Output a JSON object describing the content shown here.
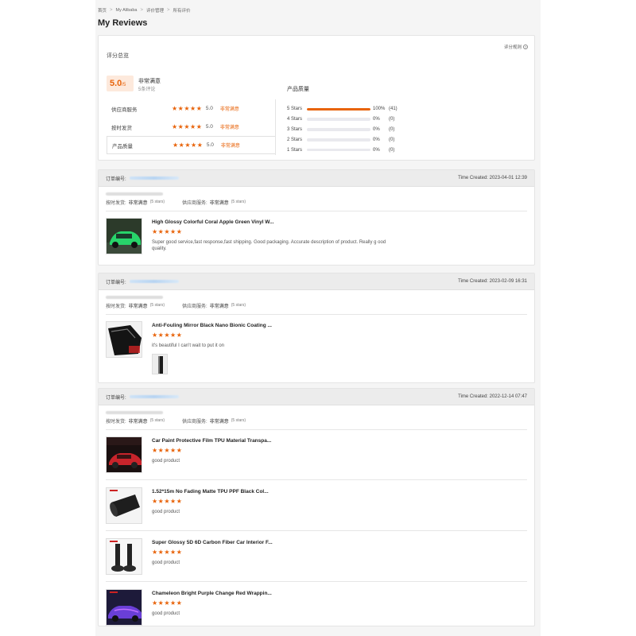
{
  "breadcrumb": [
    "首页",
    "My Alibaba",
    "评价管理",
    "所有评价"
  ],
  "page_title": "My Reviews",
  "summary": {
    "title": "评分总览",
    "rules_label": "评分规则",
    "score": "5.0",
    "score_suffix": "/5",
    "score_label": "非常满意",
    "review_count": "5条评论",
    "ratings": [
      {
        "name": "供应商服务",
        "value": "5.0",
        "text": "非常满意",
        "stars": 5
      },
      {
        "name": "按时发货",
        "value": "5.0",
        "text": "非常满意",
        "stars": 5
      },
      {
        "name": "产品质量",
        "value": "5.0",
        "text": "非常满意",
        "stars": 5
      }
    ],
    "distribution_title": "产品质量",
    "distribution": [
      {
        "label": "5 Stars",
        "percent": "100%",
        "count": "(41)",
        "fill": 1.0
      },
      {
        "label": "4 Stars",
        "percent": "0%",
        "count": "(0)",
        "fill": 0
      },
      {
        "label": "3 Stars",
        "percent": "0%",
        "count": "(0)",
        "fill": 0
      },
      {
        "label": "2 Stars",
        "percent": "0%",
        "count": "(0)",
        "fill": 0
      },
      {
        "label": "1 Stars",
        "percent": "0%",
        "count": "(0)",
        "fill": 0
      }
    ]
  },
  "orders": [
    {
      "order_label": "订单编号:",
      "time_created": "Time Created: 2023-04-01 12:39",
      "ontime_label": "按时发货:",
      "ontime_value": "非常满意",
      "ontime_stars": "(5 stars)",
      "service_label": "供应商服务:",
      "service_value": "非常满意",
      "service_stars": "(5 stars)",
      "items": [
        {
          "title": "High Glossy Colorful Coral Apple Green Vinyl W...",
          "text": "Super good service,fast response,fast shipping. Good packaging. Accurate description of product. Really g ood quality.",
          "thumb": "green-car"
        }
      ]
    },
    {
      "order_label": "订单编号:",
      "time_created": "Time Created: 2023-02-09 16:31",
      "ontime_label": "按时发货:",
      "ontime_value": "非常满意",
      "ontime_stars": "(5 stars)",
      "service_label": "供应商服务:",
      "service_value": "非常满意",
      "service_stars": "(5 stars)",
      "items": [
        {
          "title": "Anti-Fouling Mirror Black Nano Bionic Coating ...",
          "text": "it's beautiful I can't wait to put it on",
          "thumb": "black-film",
          "photo": true
        }
      ]
    },
    {
      "order_label": "订单编号:",
      "time_created": "Time Created: 2022-12-14 07:47",
      "ontime_label": "按时发货:",
      "ontime_value": "非常满意",
      "ontime_stars": "(5 stars)",
      "service_label": "供应商服务:",
      "service_value": "非常满意",
      "service_stars": "(5 stars)",
      "items": [
        {
          "title": "Car Paint Protective Film TPU Material Transpa...",
          "text": "good product",
          "thumb": "red-car"
        },
        {
          "title": "1.52*15m No Fading Matte TPU PPF Black Col...",
          "text": "good product",
          "thumb": "black-roll"
        },
        {
          "title": "Super Glossy 5D 6D Carbon Fiber Car Interior F...",
          "text": "good product",
          "thumb": "carbon-rolls"
        },
        {
          "title": "Chameleon Bright Purple Change Red Wrappin...",
          "text": "good product",
          "thumb": "purple-car"
        }
      ]
    }
  ],
  "colors": {
    "accent": "#e8630a",
    "bar_empty": "#e9e9ee",
    "header_bg": "#ececec"
  },
  "icons": {
    "star": "star-icon",
    "breadcrumb_sep": "chevron-right-icon",
    "help": "question-circle-icon"
  }
}
